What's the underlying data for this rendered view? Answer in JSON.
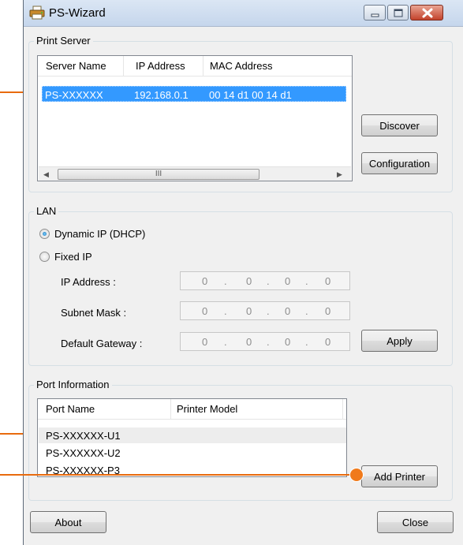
{
  "window": {
    "title": "PS-Wizard"
  },
  "print_server": {
    "group_label": "Print Server",
    "columns": [
      "Server Name",
      "IP Address",
      "MAC Address"
    ],
    "rows": [
      {
        "server_name": "PS-XXXXXX",
        "ip_address": "192.168.0.1",
        "mac_address": "00 14 d1 00 14 d1",
        "selected": true
      }
    ],
    "discover_label": "Discover",
    "configuration_label": "Configuration",
    "scrollbar_thumb_glyph": "III"
  },
  "lan": {
    "group_label": "LAN",
    "dhcp_label": "Dynamic IP (DHCP)",
    "dhcp_selected": true,
    "fixed_label": "Fixed IP",
    "fixed_selected": false,
    "fields": [
      {
        "label": "IP Address :",
        "octets": [
          "0",
          "0",
          "0",
          "0"
        ]
      },
      {
        "label": "Subnet Mask :",
        "octets": [
          "0",
          "0",
          "0",
          "0"
        ]
      },
      {
        "label": "Default Gateway :",
        "octets": [
          "0",
          "0",
          "0",
          "0"
        ]
      }
    ],
    "apply_label": "Apply"
  },
  "port_information": {
    "group_label": "Port Information",
    "columns": [
      "Port Name",
      "Printer Model"
    ],
    "rows": [
      {
        "port_name": "PS-XXXXXX-U1",
        "printer_model": ""
      },
      {
        "port_name": "PS-XXXXXX-U2",
        "printer_model": ""
      },
      {
        "port_name": "PS-XXXXXX-P3",
        "printer_model": ""
      }
    ],
    "add_printer_label": "Add Printer"
  },
  "footer": {
    "about_label": "About",
    "close_label": "Close"
  },
  "colors": {
    "callout": "#f07a1b",
    "selection": "#3399ff"
  },
  "icons": [
    "printer-icon",
    "minimize-icon",
    "maximize-icon",
    "close-icon",
    "scroll-left-icon",
    "scroll-right-icon"
  ]
}
